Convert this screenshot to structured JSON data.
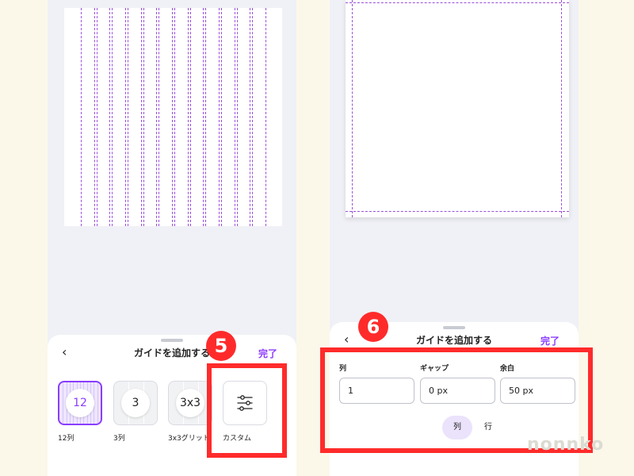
{
  "left": {
    "sheet_title": "ガイドを追加する",
    "done_label": "完了",
    "back_icon": "chevron-left-icon",
    "presets": [
      {
        "value": "12",
        "label": "12列",
        "selected": true
      },
      {
        "value": "3",
        "label": "3列",
        "selected": false
      },
      {
        "value": "3x3",
        "label": "3x3グリット",
        "selected": false
      }
    ],
    "custom": {
      "label": "カスタム",
      "icon": "sliders-icon"
    },
    "step_badge": "5"
  },
  "right": {
    "sheet_title": "ガイドを追加する",
    "done_label": "完了",
    "back_icon": "chevron-left-icon",
    "fields": [
      {
        "label": "列",
        "value": "1"
      },
      {
        "label": "ギャップ",
        "value": "0 px"
      },
      {
        "label": "余白",
        "value": "50 px"
      }
    ],
    "tabs": [
      {
        "label": "列",
        "active": true
      },
      {
        "label": "行",
        "active": false
      }
    ],
    "step_badge": "6"
  },
  "watermark": "nonnko",
  "colors": {
    "accent": "#8b3dff",
    "annotation_red": "#ff2b2b",
    "guide_line": "#9b4fd8",
    "background": "#fbf8ea"
  }
}
